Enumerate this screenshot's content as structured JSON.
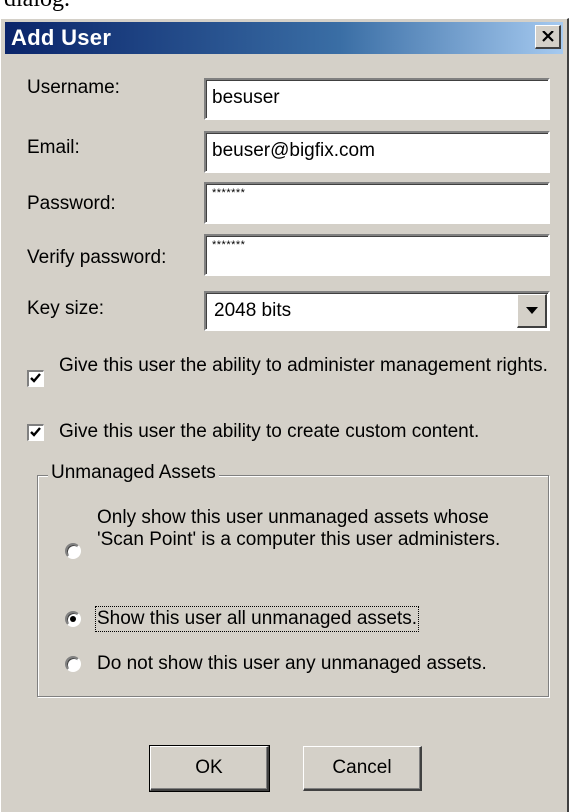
{
  "document_fragment": "dialog.",
  "window": {
    "title": "Add User"
  },
  "form": {
    "username_label": "Username:",
    "username_value": "besuser",
    "email_label": "Email:",
    "email_value": "beuser@bigfix.com",
    "password_label": "Password:",
    "password_value": "*******",
    "verify_label": "Verify password:",
    "verify_value": "*******",
    "keysize_label": "Key size:",
    "keysize_value": "2048 bits"
  },
  "options": {
    "admin_rights_label": "Give this user the ability to administer management rights.",
    "admin_rights_checked": true,
    "custom_content_label": "Give this user the ability to create custom content.",
    "custom_content_checked": true
  },
  "unmanaged_assets": {
    "legend": "Unmanaged Assets",
    "options": [
      {
        "label": "Only show this user unmanaged assets whose 'Scan Point' is a computer this user administers.",
        "selected": false
      },
      {
        "label": "Show this user all unmanaged assets.",
        "selected": true
      },
      {
        "label": "Do not show this user any unmanaged assets.",
        "selected": false
      }
    ]
  },
  "buttons": {
    "ok": "OK",
    "cancel": "Cancel"
  },
  "icons": {
    "close": "close-icon",
    "dropdown": "chevron-down-icon",
    "check": "checkmark-icon"
  }
}
